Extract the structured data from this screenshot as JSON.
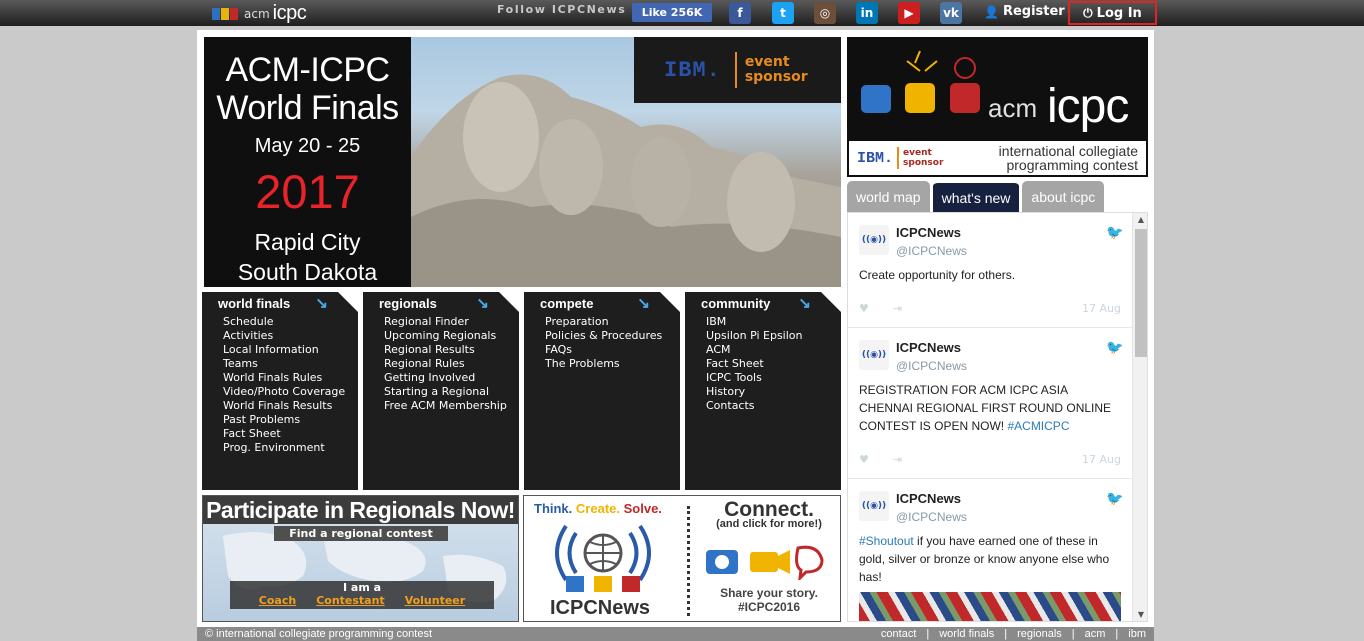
{
  "topbar": {
    "logo_acm": "acm",
    "logo_icpc": "icpc",
    "follow_text": "Follow ICPCNews",
    "fb_like": "Like 256K",
    "social": [
      {
        "icon": "facebook-icon",
        "glyph": "f",
        "color": "#3b5998"
      },
      {
        "icon": "twitter-icon",
        "glyph": "t",
        "color": "#1da1f2"
      },
      {
        "icon": "instagram-icon",
        "glyph": "◎",
        "color": "#6b4f3a"
      },
      {
        "icon": "linkedin-icon",
        "glyph": "in",
        "color": "#0077b5"
      },
      {
        "icon": "youtube-icon",
        "glyph": "▶",
        "color": "#cc1f1f"
      },
      {
        "icon": "vk-icon",
        "glyph": "vk",
        "color": "#4c75a3"
      }
    ],
    "register": "Register",
    "login": "Log In"
  },
  "hero": {
    "title_line1": "ACM-ICPC",
    "title_line2": "World Finals",
    "dates": "May 20 - 25",
    "year": "2017",
    "city_line1": "Rapid City",
    "city_line2": "South Dakota",
    "sponsor_ibm": "IBM.",
    "sponsor_event_line1": "event",
    "sponsor_event_line2": "sponsor"
  },
  "brand": {
    "acm": "acm",
    "icpc": "icpc",
    "ibm": "IBM.",
    "event_line1": "event",
    "event_line2": "sponsor",
    "intl_line1": "international collegiate",
    "intl_line2": "programming contest"
  },
  "tabs": [
    "world map",
    "what's new",
    "about icpc"
  ],
  "menus": [
    {
      "title": "world finals",
      "items": [
        "Schedule",
        "Activities",
        "Local Information",
        "Teams",
        "World Finals Rules",
        "Video/Photo Coverage",
        "World Finals Results",
        "Past Problems",
        "Fact Sheet",
        "Prog. Environment"
      ]
    },
    {
      "title": "regionals",
      "items": [
        "Regional Finder",
        "Upcoming Regionals",
        "Regional Results",
        "Regional Rules",
        "Getting Involved",
        "Starting a Regional",
        "Free ACM Membership"
      ]
    },
    {
      "title": "compete",
      "items": [
        "Preparation",
        "Policies & Procedures",
        "FAQs",
        "The Problems"
      ]
    },
    {
      "title": "community",
      "items": [
        "IBM",
        "Upsilon Pi Epsilon",
        "ACM",
        "Fact Sheet",
        "ICPC Tools",
        "History",
        "Contacts"
      ]
    }
  ],
  "tweets": [
    {
      "name": "ICPCNews",
      "handle": "@ICPCNews",
      "text": "Create opportunity for others.",
      "tag": "",
      "date": "17 Aug"
    },
    {
      "name": "ICPCNews",
      "handle": "@ICPCNews",
      "text": "REGISTRATION FOR ACM ICPC ASIA CHENNAI REGIONAL FIRST ROUND ONLINE CONTEST IS OPEN NOW! ",
      "tag": "#ACMICPC",
      "date": "17 Aug"
    },
    {
      "name": "ICPCNews",
      "handle": "@ICPCNews",
      "tag_lead": "#Shoutout",
      "text": " if you have earned one of these in gold, silver or bronze or know anyone else who has!",
      "date": ""
    }
  ],
  "promo_regionals": {
    "title": "Participate in Regionals Now!",
    "find": "Find a regional contest",
    "i_am": "I am a",
    "options": [
      "Coach",
      "Contestant",
      "Volunteer"
    ]
  },
  "promo_news": {
    "think": "Think.",
    "create": "Create.",
    "solve": "Solve.",
    "brand": "ICPCNews",
    "connect": "Connect.",
    "connect_sub": "(and click for more!)",
    "share_line1": "Share your story.",
    "share_line2": "#ICPC2016",
    "colors": {
      "think": "#2a5aa8",
      "create": "#f0b400",
      "solve": "#c0282a"
    }
  },
  "footer": {
    "copyright": "© international collegiate programming contest",
    "links": [
      "contact",
      "world finals",
      "regionals",
      "acm",
      "ibm"
    ]
  }
}
